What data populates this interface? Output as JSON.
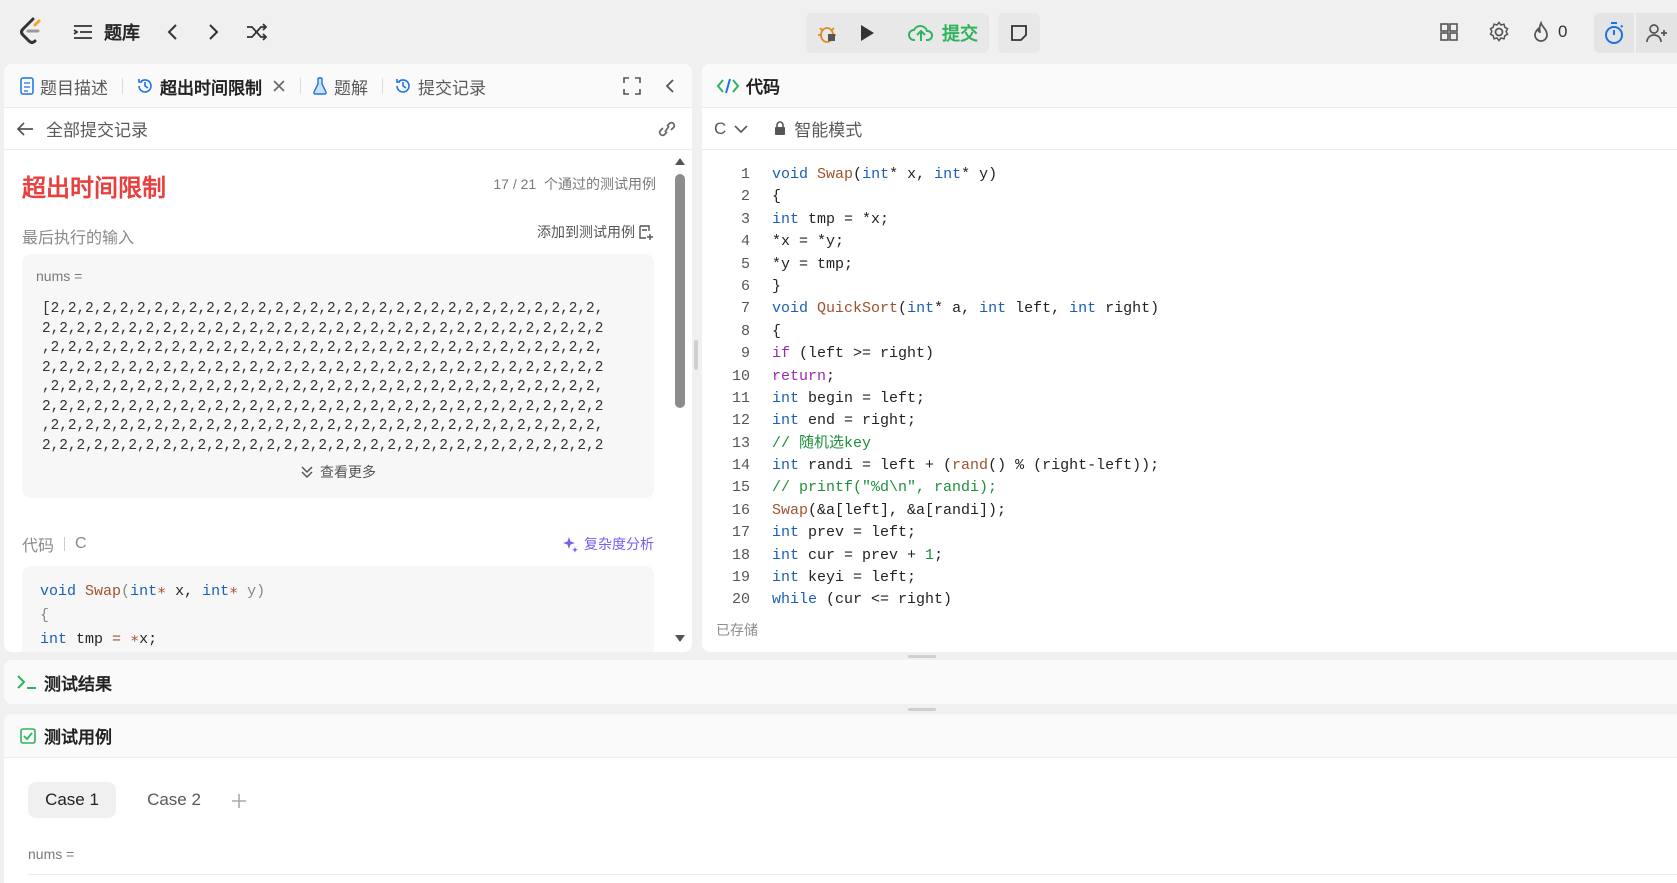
{
  "topbar": {
    "problem_bank": "题库",
    "submit": "提交",
    "streak_count": "0"
  },
  "left": {
    "tabs": {
      "description": "题目描述",
      "result": "超出时间限制",
      "solutions": "题解",
      "submissions": "提交记录"
    },
    "back_label": "全部提交记录",
    "status": "超出时间限制",
    "passed": "17 / 21",
    "passed_label": "个通过的测试用例",
    "last_input_label": "最后执行的输入",
    "add_testcase": "添加到测试用例",
    "input_var": "nums =",
    "input_lines": [
      "[2,2,2,2,2,2,2,2,2,2,2,2,2,2,2,2,2,2,2,2,2,2,2,2,2,2,2,2,2,2,2,2,",
      "2,2,2,2,2,2,2,2,2,2,2,2,2,2,2,2,2,2,2,2,2,2,2,2,2,2,2,2,2,2,2,2,2",
      ",2,2,2,2,2,2,2,2,2,2,2,2,2,2,2,2,2,2,2,2,2,2,2,2,2,2,2,2,2,2,2,2,",
      "2,2,2,2,2,2,2,2,2,2,2,2,2,2,2,2,2,2,2,2,2,2,2,2,2,2,2,2,2,2,2,2,2",
      ",2,2,2,2,2,2,2,2,2,2,2,2,2,2,2,2,2,2,2,2,2,2,2,2,2,2,2,2,2,2,2,2,",
      "2,2,2,2,2,2,2,2,2,2,2,2,2,2,2,2,2,2,2,2,2,2,2,2,2,2,2,2,2,2,2,2,2",
      ",2,2,2,2,2,2,2,2,2,2,2,2,2,2,2,2,2,2,2,2,2,2,2,2,2,2,2,2,2,2,2,2,",
      "2,2,2,2,2,2,2,2,2,2,2,2,2,2,2,2,2,2,2,2,2,2,2,2,2,2,2,2,2,2,2,2,2"
    ],
    "show_more": "查看更多",
    "code_label": "代码",
    "code_lang": "C",
    "complexity": "复杂度分析",
    "code_preview": [
      [
        "void",
        " ",
        "Swap",
        "(",
        "int",
        "∗",
        " x, ",
        "int",
        "∗",
        " y)"
      ],
      [
        "{"
      ],
      [
        "int",
        " tmp ",
        "=",
        " ",
        "∗",
        "x;"
      ]
    ]
  },
  "editor": {
    "title": "代码",
    "lang": "C",
    "mode": "智能模式",
    "saved": "已存储",
    "line_numbers": [
      "1",
      "2",
      "3",
      "4",
      "5",
      "6",
      "7",
      "8",
      "9",
      "10",
      "11",
      "12",
      "13",
      "14",
      "15",
      "16",
      "17",
      "18",
      "19",
      "20"
    ],
    "lines": [
      "void Swap(int* x, int* y)",
      "{",
      "int tmp = *x;",
      "*x = *y;",
      "*y = tmp;",
      "}",
      "void QuickSort(int* a, int left, int right)",
      "{",
      "if (left >= right)",
      "return;",
      "int begin = left;",
      "int end = right;",
      "// 随机选key",
      "int randi = left + (rand() % (right-left));",
      "// printf(\"%d\\n\", randi);",
      "Swap(&a[left], &a[randi]);",
      "int prev = left;",
      "int cur = prev + 1;",
      "int keyi = left;",
      "while (cur <= right)"
    ]
  },
  "results": {
    "title": "测试结果"
  },
  "testcases": {
    "title": "测试用例",
    "cases": [
      "Case 1",
      "Case 2"
    ],
    "var": "nums ="
  },
  "colors": {
    "error": "#e8403f",
    "accent_green": "#2db55d",
    "blue": "#1a73e8",
    "purple": "#7b5cf0"
  }
}
